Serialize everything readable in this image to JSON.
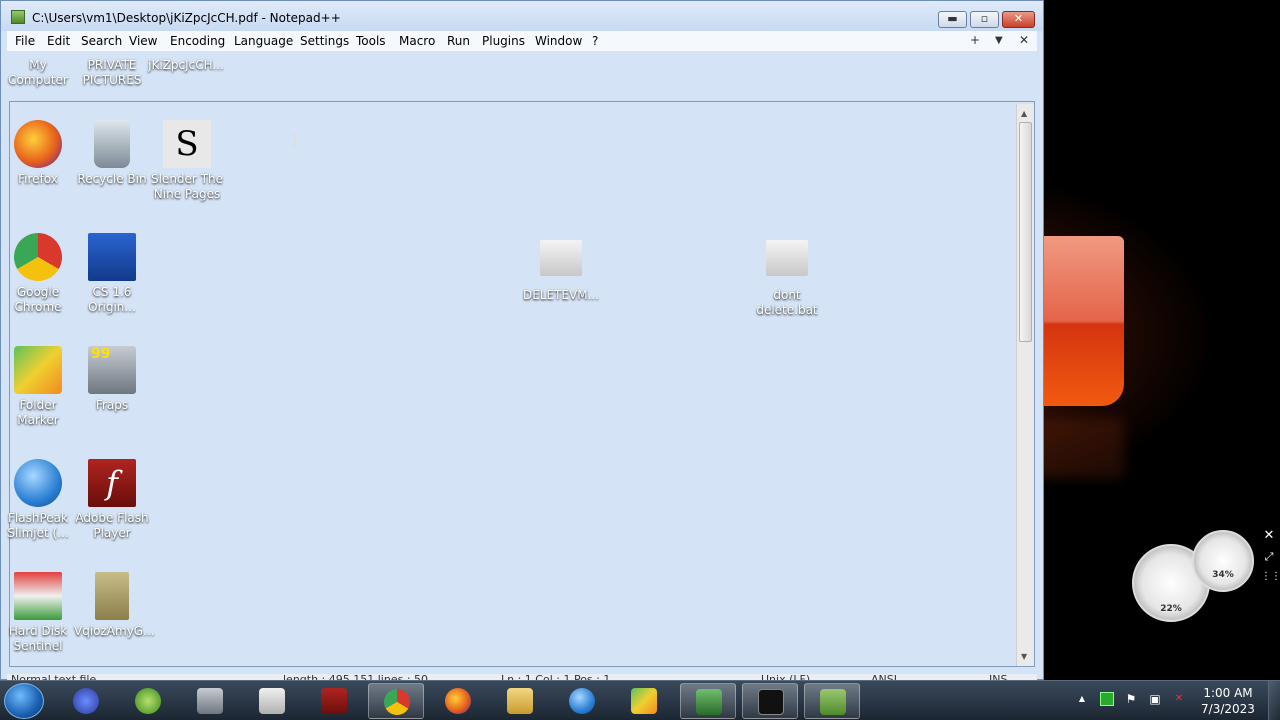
{
  "window": {
    "title": "C:\\Users\\vm1\\Desktop\\jKiZpcJcCH.pdf - Notepad++",
    "min_label": "▬",
    "max_label": "▫",
    "close_label": "✕"
  },
  "menu": {
    "items": [
      "File",
      "Edit",
      "Search",
      "View",
      "Encoding",
      "Language",
      "Settings",
      "Tools",
      "Macro",
      "Run",
      "Plugins",
      "Window",
      "?"
    ],
    "right_add": "+",
    "right_dropdown": "▼",
    "right_close": "✕"
  },
  "desktop": {
    "top_row": [
      "My Computer",
      "PRIVATE PICTURES",
      "jKiZpcJcCH..."
    ],
    "icons": [
      {
        "label": "Firefox",
        "icon": "firefox-icon",
        "color": "#e8621c"
      },
      {
        "label": "Recycle Bin",
        "icon": "recycle-bin-icon",
        "color": "#9aa8b4"
      },
      {
        "label": "Slender The Nine Pages",
        "icon": "slender-icon",
        "color": "#e0e0e0"
      },
      {
        "label": "Google Chrome",
        "icon": "chrome-icon",
        "color": "#d9382c"
      },
      {
        "label": "CS 1.6 Origin...",
        "icon": "cs-icon",
        "color": "#1c4fb0"
      },
      {
        "label": "DELETEVM...",
        "icon": "batch-file-icon",
        "color": "#dcdcdc"
      },
      {
        "label": "dont delete.bat",
        "icon": "batch-file-icon",
        "color": "#dcdcdc"
      },
      {
        "label": "Folder Marker",
        "icon": "folder-marker-icon",
        "color": "#3aa63a"
      },
      {
        "label": "Fraps",
        "icon": "fraps-icon",
        "color": "#8a9098"
      },
      {
        "label": "FlashPeak Slimjet (...",
        "icon": "slimjet-icon",
        "color": "#2b7fd4"
      },
      {
        "label": "Adobe Flash Player",
        "icon": "flash-icon",
        "color": "#9b1a16"
      },
      {
        "label": "Hard Disk Sentinel",
        "icon": "hdsentinel-icon",
        "color": "#d84040"
      },
      {
        "label": "VqiozAmyG...",
        "icon": "folder-icon",
        "color": "#a89a60"
      }
    ]
  },
  "status": {
    "items": [
      "Normal text file",
      "length : 495,151    lines : 50",
      "Ln : 1    Col : 1    Pos : 1",
      "Unix (LF)",
      "ANSI",
      "INS"
    ]
  },
  "gadget": {
    "cpu": "22%",
    "mem": "34%",
    "close": "✕",
    "expand": "⤢",
    "grip": "⋮⋮"
  },
  "clock": {
    "time": "1:00 AM",
    "date": "7/3/2023"
  },
  "taskbar": {
    "chevron": "▲",
    "mute": "✕"
  }
}
